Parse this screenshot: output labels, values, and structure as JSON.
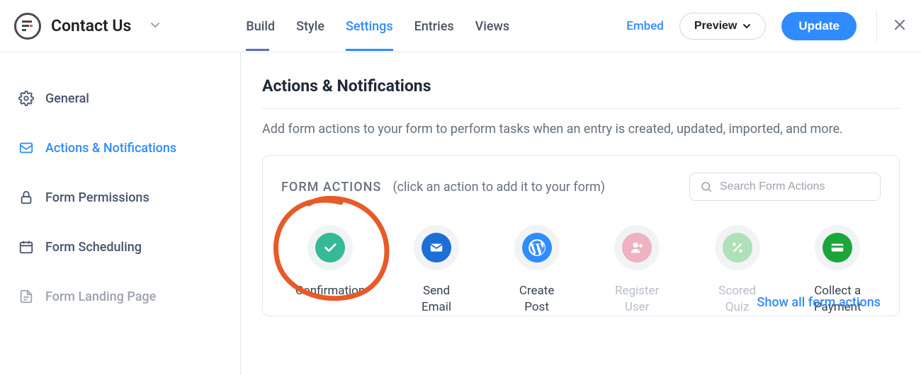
{
  "header": {
    "form_title": "Contact Us",
    "tabs": {
      "build": "Build",
      "style": "Style",
      "settings": "Settings",
      "entries": "Entries",
      "views": "Views"
    },
    "embed": "Embed",
    "preview": "Preview",
    "update": "Update"
  },
  "sidebar": {
    "general": "General",
    "actions": "Actions & Notifications",
    "permissions": "Form Permissions",
    "scheduling": "Form Scheduling",
    "landing": "Form Landing Page"
  },
  "main": {
    "title": "Actions & Notifications",
    "desc": "Add form actions to your form to perform tasks when an entry is created, updated, imported, and more.",
    "form_actions_label": "FORM ACTIONS",
    "form_actions_hint": "(click an action to add it to your form)",
    "search_placeholder": "Search Form Actions",
    "show_all": "Show all form actions",
    "actions": {
      "confirmation": "Confirmation",
      "send_email": "Send Email",
      "create_post": "Create Post",
      "register_user": "Register User",
      "scored_quiz": "Scored Quiz",
      "collect_payment": "Collect a Payment"
    }
  },
  "colors": {
    "accent": "#2f8cff",
    "confirm": "#35b997",
    "email": "#1b6fd6",
    "wp": "#2f8cff",
    "register": "#eeb2c0",
    "quiz": "#b0e0b7",
    "payment": "#1aa63a",
    "marker": "#e85a27"
  }
}
